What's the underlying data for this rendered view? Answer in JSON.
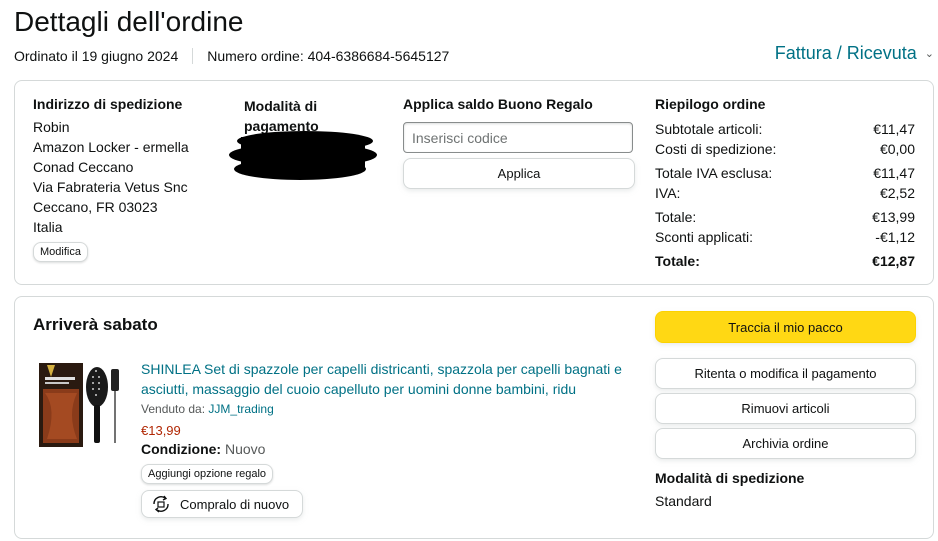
{
  "page": {
    "title": "Dettagli dell'ordine",
    "ordered_on": "Ordinato il 19 giugno 2024",
    "order_number": "Numero ordine: 404-6386684-5645127",
    "invoice_label": "Fattura / Ricevuta"
  },
  "shipping_address": {
    "heading": "Indirizzo di spedizione",
    "lines": [
      "Robin",
      "Amazon Locker - ermella",
      "Conad Ceccano",
      "Via Fabrateria Vetus Snc",
      "Ceccano, FR 03023",
      "Italia"
    ],
    "edit_label": "Modifica"
  },
  "payment": {
    "heading_line1": "Modalità di",
    "heading_line2": "pagamento"
  },
  "gift_card": {
    "heading": "Applica saldo Buono Regalo",
    "placeholder": "Inserisci codice",
    "apply_label": "Applica"
  },
  "summary": {
    "heading": "Riepilogo ordine",
    "rows": [
      {
        "label": "Subtotale articoli:",
        "value": "€11,47"
      },
      {
        "label": "Costi di spedizione:",
        "value": "€0,00"
      },
      {
        "label": "Totale IVA esclusa:",
        "value": "€11,47"
      },
      {
        "label": "IVA:",
        "value": "€2,52"
      },
      {
        "label": "Totale:",
        "value": "€13,99"
      },
      {
        "label": "Sconti applicati:",
        "value": "-€1,12"
      },
      {
        "label": "Totale:",
        "value": "€12,87"
      }
    ]
  },
  "shipment": {
    "status": "Arriverà sabato",
    "item": {
      "title": "SHINLEA Set di spazzole per capelli districanti, spazzola per capelli bagnati e asciutti, massaggio del cuoio capelluto per uomini donne bambini, ridu",
      "sold_by_label": "Venduto da:",
      "seller": "JJM_trading",
      "price": "€13,99",
      "condition_label": "Condizione:",
      "condition_value": "Nuovo",
      "gift_option_label": "Aggiungi opzione regalo",
      "buy_again_label": "Compralo di nuovo"
    },
    "actions": {
      "track": "Traccia il mio pacco",
      "retry_payment": "Ritenta o modifica il pagamento",
      "remove_items": "Rimuovi articoli",
      "archive": "Archivia ordine"
    },
    "shipping_method_heading": "Modalità di spedizione",
    "shipping_method_value": "Standard"
  },
  "colors": {
    "link": "#007185",
    "price": "#b12704",
    "primary_button": "#ffd814",
    "border": "#d5d9d9"
  }
}
